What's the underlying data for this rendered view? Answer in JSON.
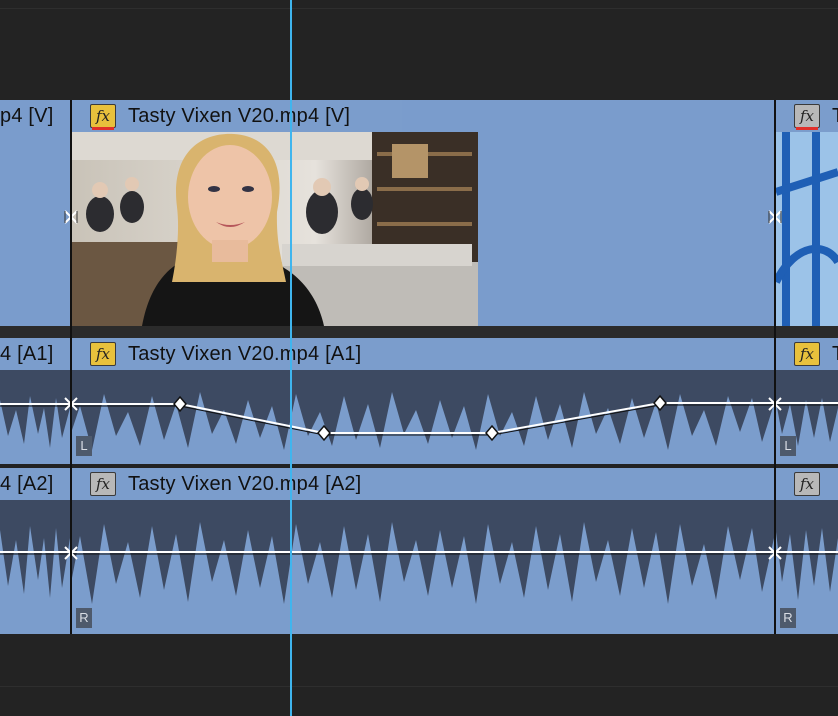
{
  "video_track": {
    "prev_clip_label": "p4 [V]",
    "clip_label": "Tasty Vixen V20.mp4 [V]",
    "next_clip_fx": "fx",
    "next_clip_label": "T"
  },
  "audio_track_1": {
    "prev_clip_label": "4 [A1]",
    "clip_label": "Tasty Vixen V20.mp4 [A1]",
    "next_clip_label": "T",
    "channel": "L"
  },
  "audio_track_2": {
    "prev_clip_label": "4 [A2]",
    "clip_label": "Tasty Vixen V20.mp4 [A2]",
    "channel": "R",
    "next_channel": "R"
  },
  "fx_badge": "fx",
  "colors": {
    "clip": "#7b9dcc",
    "waveform": "#3d4a62",
    "playhead": "#3fb5ee",
    "fx_enabled": "#e8c13c",
    "fx_disabled": "#b8b8b8",
    "fx_underline": "#e0302a"
  }
}
